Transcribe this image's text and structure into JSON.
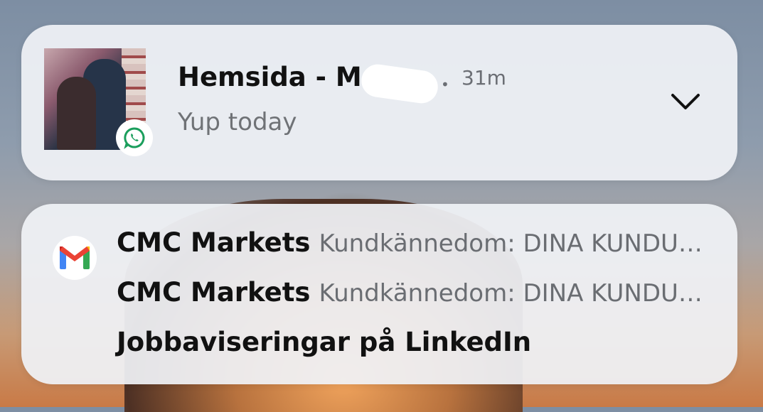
{
  "whatsapp_notification": {
    "title": "Hemsida - M",
    "separator": "•",
    "time": "31m",
    "message": "Yup today",
    "app_badge_icon": "whatsapp-icon",
    "expand_icon": "chevron-down-icon",
    "accent_color": "#1a9e5c"
  },
  "gmail_notification": {
    "app_icon": "gmail-icon",
    "rows": [
      {
        "sender": "CMC Markets",
        "subject": "Kundkännedom: DINA KUNDU…"
      },
      {
        "sender": "CMC Markets",
        "subject": "Kundkännedom: DINA KUNDU…"
      },
      {
        "sender": "Jobbaviseringar på LinkedIn",
        "subject": ""
      }
    ]
  }
}
